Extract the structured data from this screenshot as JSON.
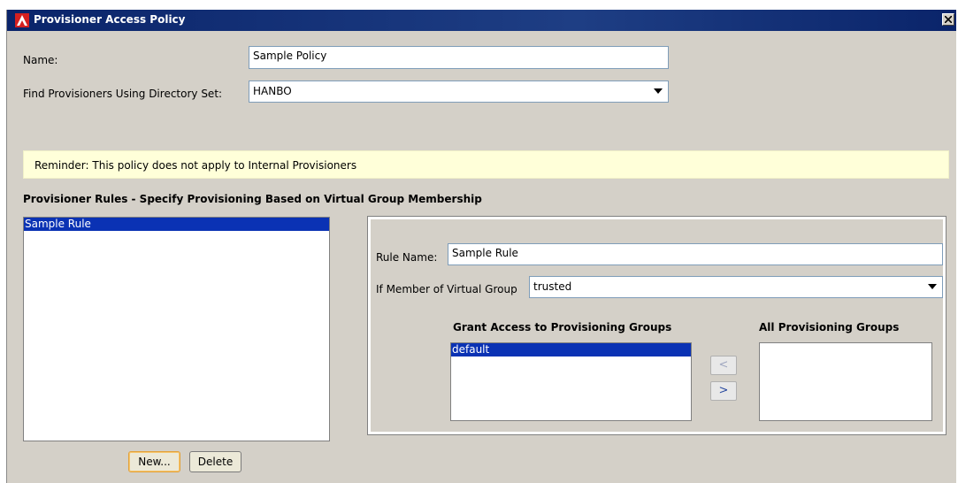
{
  "window": {
    "title": "Provisioner Access Policy"
  },
  "form": {
    "name_label": "Name:",
    "name_value": "Sample Policy",
    "directory_set_label": "Find Provisioners Using Directory Set:",
    "directory_set_value": "HANBO"
  },
  "reminder": {
    "text": "Reminder:  This policy does not apply to Internal Provisioners"
  },
  "rules": {
    "section_title": "Provisioner Rules - Specify Provisioning Based on Virtual Group Membership",
    "items": [
      {
        "label": "Sample Rule",
        "selected": true
      }
    ],
    "new_button": "New...",
    "delete_button": "Delete"
  },
  "rule_detail": {
    "rule_name_label": "Rule Name:",
    "rule_name_value": "Sample Rule",
    "virtual_group_label": "If Member of Virtual Group",
    "virtual_group_value": "trusted",
    "granted_title": "Grant Access to Provisioning Groups",
    "granted_items": [
      {
        "label": "default",
        "selected": true
      }
    ],
    "all_title": "All Provisioning Groups",
    "all_items": [],
    "add_arrow": "<",
    "remove_arrow": ">"
  },
  "colors": {
    "titlebar": "#0a246a",
    "dialog_bg": "#d4d0c8",
    "selection": "#0a32b4",
    "reminder_bg": "#ffffd9",
    "app_icon": "#d42020"
  },
  "icons": {
    "app": "app-logo-icon",
    "close": "close-icon",
    "dropdown": "chevron-down-icon"
  }
}
